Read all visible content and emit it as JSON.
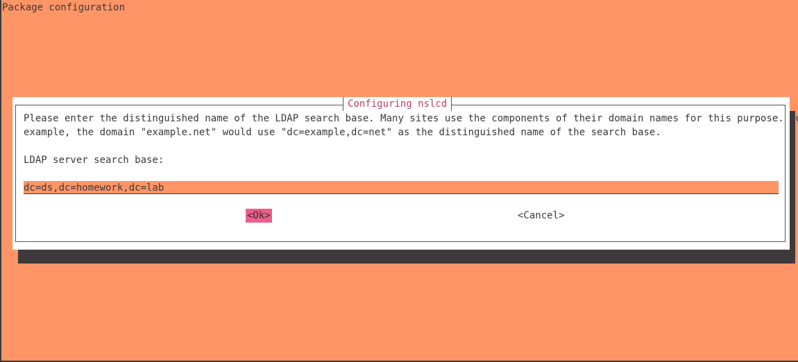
{
  "backtitle": "Package configuration",
  "dialog": {
    "title": "Configuring nslcd",
    "prompt_line1": "Please enter the distinguished name of the LDAP search base. Many sites use the components of their domain names for this purpose. For",
    "prompt_line2": "example, the domain \"example.net\" would use \"dc=example,dc=net\" as the distinguished name of the search base.",
    "input_label": "LDAP server search base:",
    "input_value": "dc=ds,dc=homework,dc=lab",
    "ok_label": "<Ok>",
    "cancel_label": "<Cancel>"
  },
  "colors": {
    "background": "#fe9566",
    "dialog": "#ffffff",
    "title": "#b83f6a",
    "selected_button": "#ef5d8b",
    "shadow": "#3e3a3c"
  }
}
